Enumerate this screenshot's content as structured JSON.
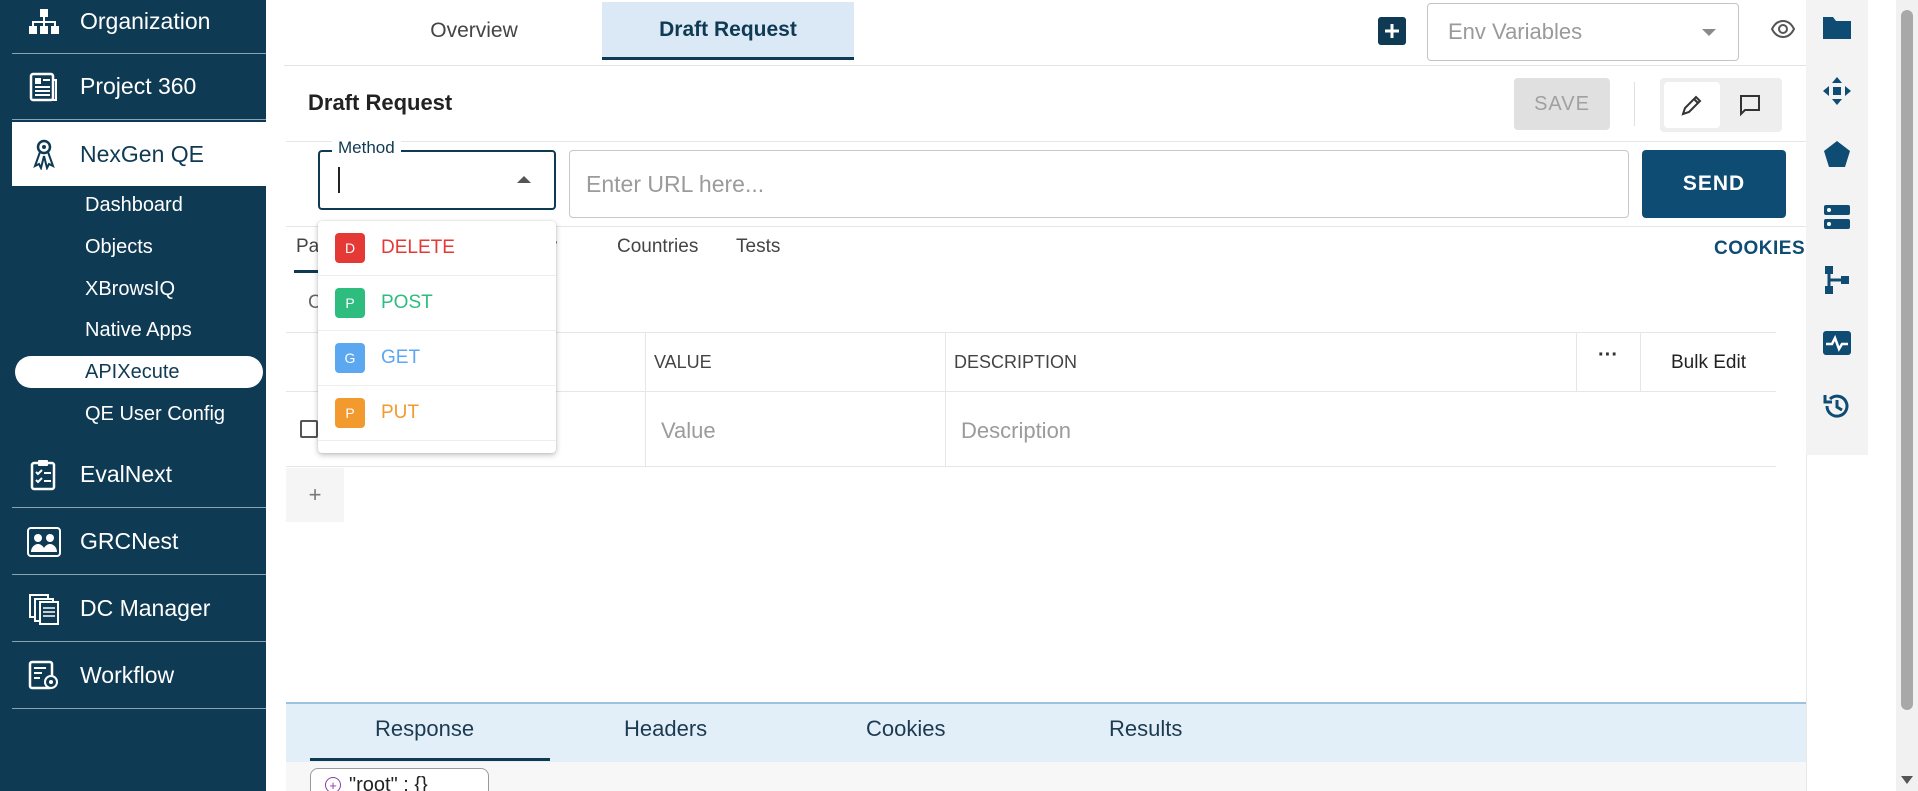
{
  "sidebar": {
    "items": [
      {
        "label": "Organization",
        "icon": "organization-icon"
      },
      {
        "label": "Project 360",
        "icon": "project-icon"
      },
      {
        "label": "NexGen QE",
        "icon": "nexgen-icon"
      },
      {
        "label": "EvalNext",
        "icon": "clipboard-icon"
      },
      {
        "label": "GRCNest",
        "icon": "people-icon"
      },
      {
        "label": "DC Manager",
        "icon": "documents-icon"
      },
      {
        "label": "Workflow",
        "icon": "workflow-icon"
      }
    ],
    "sub_items": [
      "Dashboard",
      "Objects",
      "XBrowsIQ",
      "Native Apps",
      "APIXecute",
      "QE User Config"
    ],
    "active_sub": "APIXecute"
  },
  "header": {
    "tabs": [
      "Overview",
      "Draft Request"
    ],
    "active_tab": "Draft Request",
    "env_placeholder": "Env Variables"
  },
  "request": {
    "title": "Draft Request",
    "save_label": "SAVE",
    "method_label": "Method",
    "url_placeholder": "Enter URL here...",
    "send_label": "SEND",
    "tabs": [
      "Pa",
      "dy",
      "Countries",
      "Tests"
    ],
    "cookies_label": "COOKIES",
    "sub_tab_fragment": "C",
    "methods": [
      {
        "letter": "D",
        "label": "DELETE",
        "color": "#e53935"
      },
      {
        "letter": "P",
        "label": "POST",
        "color": "#2ebd7e"
      },
      {
        "letter": "G",
        "label": "GET",
        "color": "#5ca8f0"
      },
      {
        "letter": "P",
        "label": "PUT",
        "color": "#f29a2e"
      }
    ]
  },
  "params_table": {
    "columns": [
      "VALUE",
      "DESCRIPTION"
    ],
    "more_label": "···",
    "bulk_edit_label": "Bulk Edit",
    "value_placeholder": "Value",
    "description_placeholder": "Description",
    "add_label": "+"
  },
  "response": {
    "tabs": [
      "Response",
      "Headers",
      "Cookies",
      "Results"
    ],
    "active_tab": "Response",
    "json_root": "\"root\" : {}"
  },
  "colors": {
    "brand": "#0f3a53",
    "send": "#0f4c73"
  }
}
